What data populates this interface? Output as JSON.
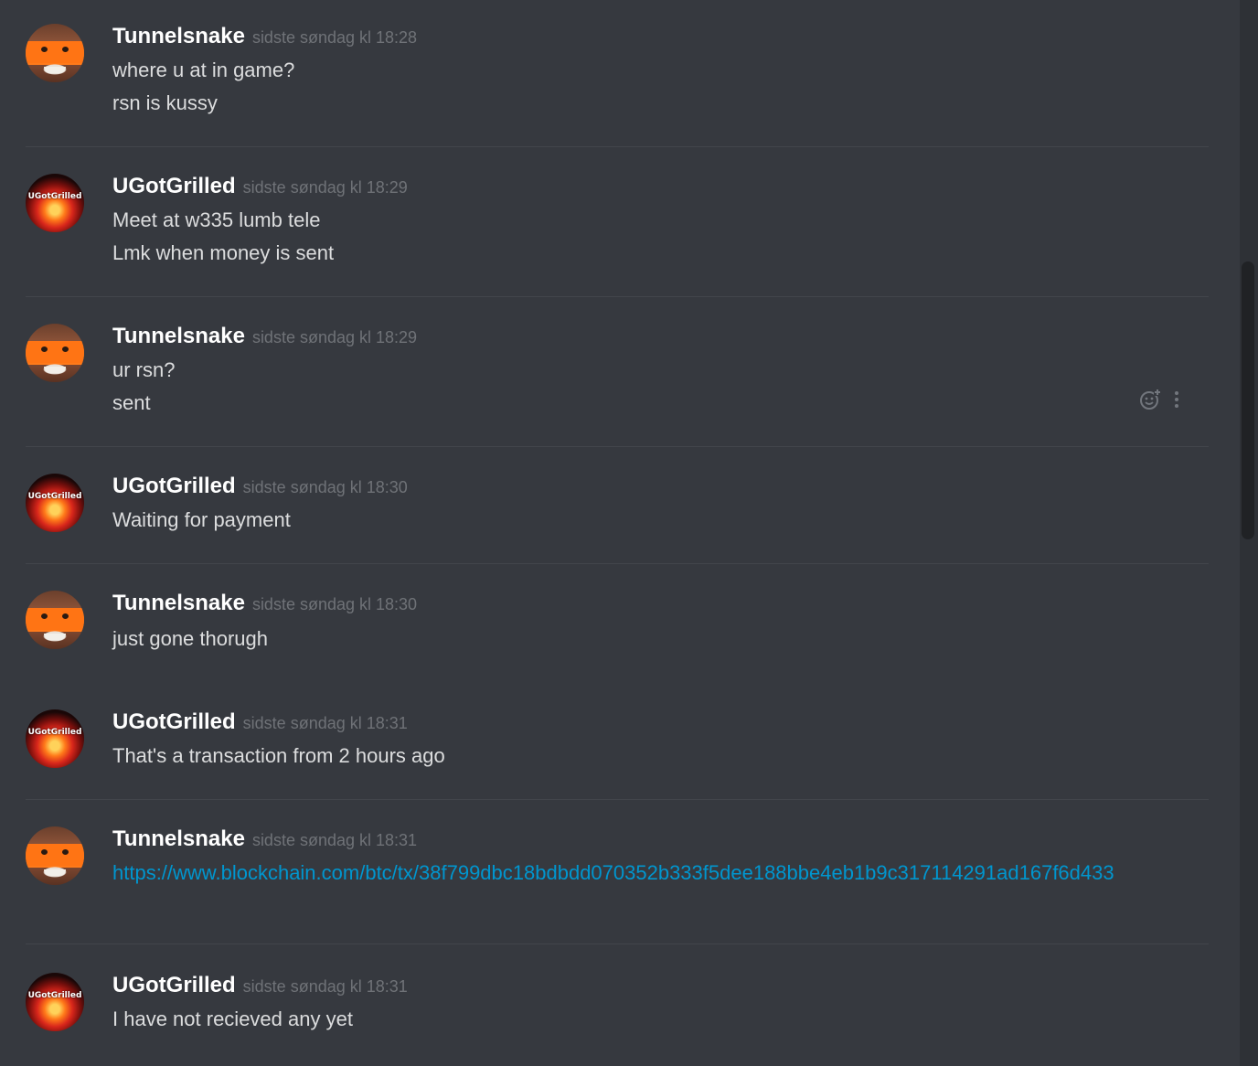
{
  "messages": [
    {
      "author": "Tunnelsnake",
      "timestamp": "sidste søndag kl 18:28",
      "avatar": "tunnelsnake-avatar",
      "lines": [
        "where u at in game?",
        "rsn is kussy"
      ]
    },
    {
      "author": "UGotGrilled",
      "timestamp": "sidste søndag kl 18:29",
      "avatar": "ugotgrilled-avatar",
      "lines": [
        "Meet at w335 lumb tele",
        "Lmk when money is sent"
      ]
    },
    {
      "author": "Tunnelsnake",
      "timestamp": "sidste søndag kl 18:29",
      "avatar": "tunnelsnake-avatar",
      "lines": [
        "ur rsn?",
        "sent"
      ]
    },
    {
      "author": "UGotGrilled",
      "timestamp": "sidste søndag kl 18:30",
      "avatar": "ugotgrilled-avatar",
      "lines": [
        "Waiting for payment"
      ]
    },
    {
      "author": "Tunnelsnake",
      "timestamp": "sidste søndag kl 18:30",
      "avatar": "tunnelsnake-avatar",
      "lines": [
        "just gone thorugh"
      ]
    },
    {
      "author": "UGotGrilled",
      "timestamp": "sidste søndag kl 18:31",
      "avatar": "ugotgrilled-avatar",
      "lines": [
        "That's a transaction from 2 hours ago"
      ]
    },
    {
      "author": "Tunnelsnake",
      "timestamp": "sidste søndag kl 18:31",
      "avatar": "tunnelsnake-avatar",
      "link": "https://www.blockchain.com/btc/tx/38f799dbc18bdbdd070352b333f5dee188bbe4eb1b9c317114291ad167f6d433"
    },
    {
      "author": "UGotGrilled",
      "timestamp": "sidste søndag kl 18:31",
      "avatar": "ugotgrilled-avatar",
      "lines": [
        "I have not recieved any yet"
      ]
    }
  ],
  "avatar_logo_text": "UGotGrilled",
  "hover_actions": {
    "icons": [
      "add-reaction-icon",
      "more-options-icon"
    ]
  },
  "colors": {
    "background": "#36393f",
    "author": "#ffffff",
    "text": "#dcddde",
    "timestamp": "#6f7277",
    "link": "#0096cf"
  }
}
